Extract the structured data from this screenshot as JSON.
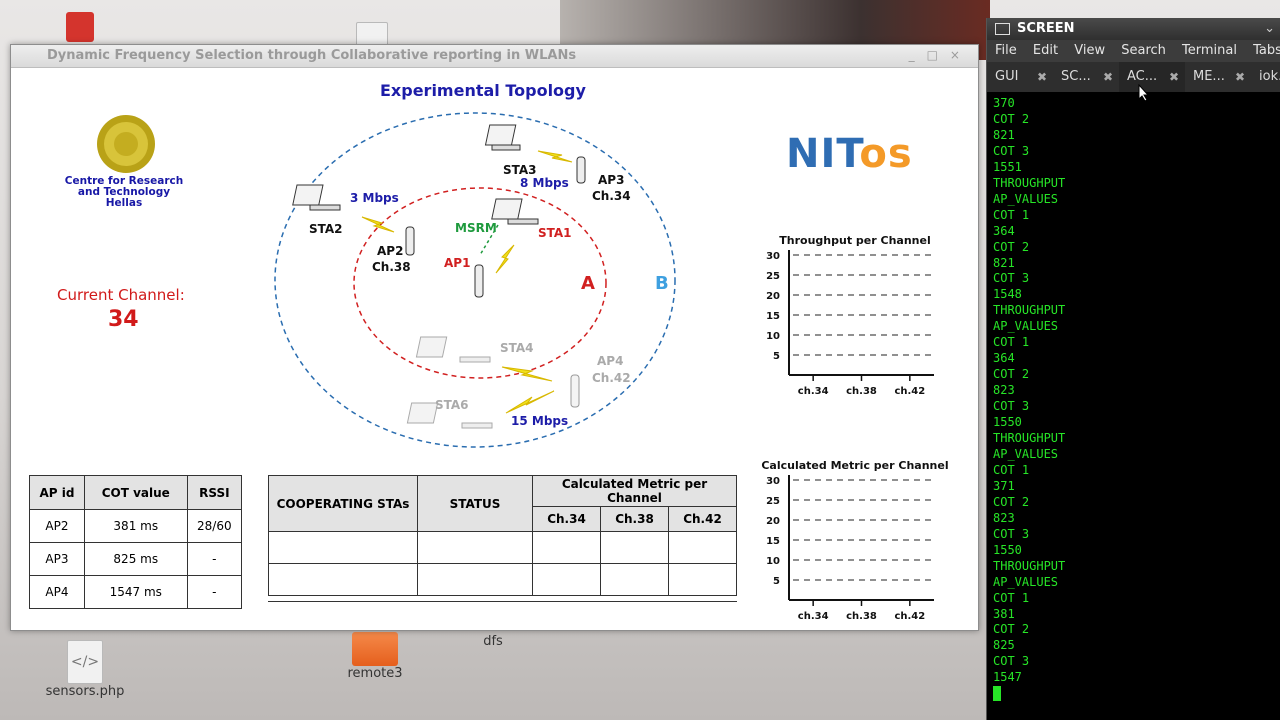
{
  "desktop": {
    "icons": [
      "sensors.php",
      "remote3",
      "dfs"
    ]
  },
  "window": {
    "title": "Dynamic Frequency Selection through  Collaborative reporting in WLANs",
    "topology_title": "Experimental Topology",
    "institution": "Centre for Research and Technology Hellas",
    "current_channel_label": "Current Channel:",
    "current_channel_value": "34",
    "logo": {
      "n": "N",
      "it": "IT",
      "os": "os"
    },
    "topology": {
      "zones": [
        "A",
        "B"
      ],
      "nodes": {
        "sta1": "STA1",
        "sta2": "STA2",
        "sta3": "STA3",
        "sta4": "STA4",
        "sta6": "STA6",
        "ap1": "AP1",
        "ap2": "AP2",
        "ap2_ch": "Ch.38",
        "ap3": "AP3",
        "ap3_ch": "Ch.34",
        "ap4": "AP4",
        "ap4_ch": "Ch.42",
        "msrm": "MSRM"
      },
      "rates": {
        "sta2_ap2": "3 Mbps",
        "sta3_ap3": "8 Mbps",
        "sta6_ap4": "15 Mbps"
      }
    },
    "ap_table": {
      "headers": [
        "AP id",
        "COT value",
        "RSSI"
      ],
      "rows": [
        [
          "AP2",
          "381 ms",
          "28/60"
        ],
        [
          "AP3",
          "825 ms",
          "-"
        ],
        [
          "AP4",
          "1547 ms",
          "-"
        ]
      ]
    },
    "coop_table": {
      "headers": [
        "COOPERATING STAs",
        "STATUS",
        "Calculated Metric per Channel"
      ],
      "subheaders": [
        "Ch.34",
        "Ch.38",
        "Ch.42"
      ]
    }
  },
  "chart_data": [
    {
      "type": "bar",
      "title": "Throughput per Channel",
      "categories": [
        "ch.34",
        "ch.38",
        "ch.42"
      ],
      "values": [
        0,
        0,
        0
      ],
      "yticks": [
        5,
        10,
        15,
        20,
        25,
        30
      ],
      "ylim": [
        0,
        30
      ],
      "grid": true
    },
    {
      "type": "bar",
      "title": "Calculated Metric per Channel",
      "categories": [
        "ch.34",
        "ch.38",
        "ch.42"
      ],
      "values": [
        0,
        0,
        0
      ],
      "yticks": [
        5,
        10,
        15,
        20,
        25,
        30
      ],
      "ylim": [
        0,
        30
      ],
      "grid": true
    }
  ],
  "terminal": {
    "title": "SCREEN",
    "menu": [
      "File",
      "Edit",
      "View",
      "Search",
      "Terminal",
      "Tabs"
    ],
    "tabs": [
      "GUI",
      "SC...",
      "AC...",
      "ME...",
      "iok..."
    ],
    "lines": [
      "370",
      "COT 2",
      "821",
      "COT 3",
      "1551",
      "THROUGHPUT",
      "AP_VALUES",
      "COT 1",
      "364",
      "COT 2",
      "821",
      "COT 3",
      "1548",
      "THROUGHPUT",
      "AP_VALUES",
      "COT 1",
      "364",
      "COT 2",
      "823",
      "COT 3",
      "1550",
      "THROUGHPUT",
      "AP_VALUES",
      "COT 1",
      "371",
      "COT 2",
      "823",
      "COT 3",
      "1550",
      "THROUGHPUT",
      "AP_VALUES",
      "COT 1",
      "381",
      "COT 2",
      "825",
      "COT 3",
      "1547"
    ]
  }
}
